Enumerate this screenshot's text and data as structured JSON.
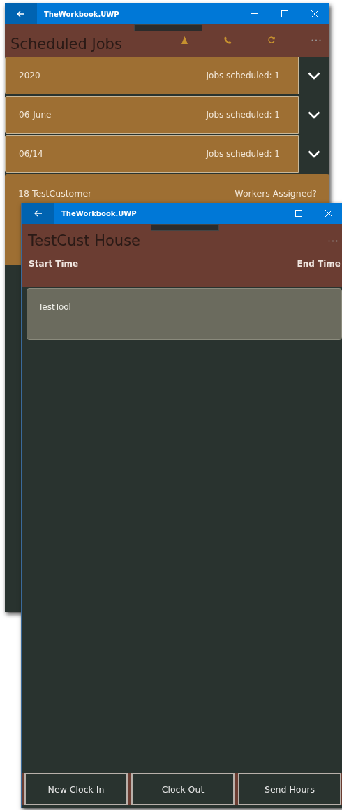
{
  "back_window": {
    "app_title": "TheWorkbook.UWP",
    "page_title": "Scheduled Jobs",
    "groups": [
      {
        "label": "2020",
        "count": "Jobs scheduled: 1"
      },
      {
        "label": "06-June",
        "count": "Jobs scheduled: 1"
      },
      {
        "label": "06/14",
        "count": "Jobs scheduled: 1"
      }
    ],
    "job": {
      "customer": "18 TestCustomer",
      "workers": "Workers Assigned?"
    }
  },
  "front_window": {
    "app_title": "TheWorkbook.UWP",
    "page_title": "TestCust House",
    "columns": [
      "Start Time",
      "End Time"
    ],
    "items": [
      "TestTool"
    ],
    "buttons": [
      "New Clock In",
      "Clock Out",
      "Send Hours"
    ]
  }
}
